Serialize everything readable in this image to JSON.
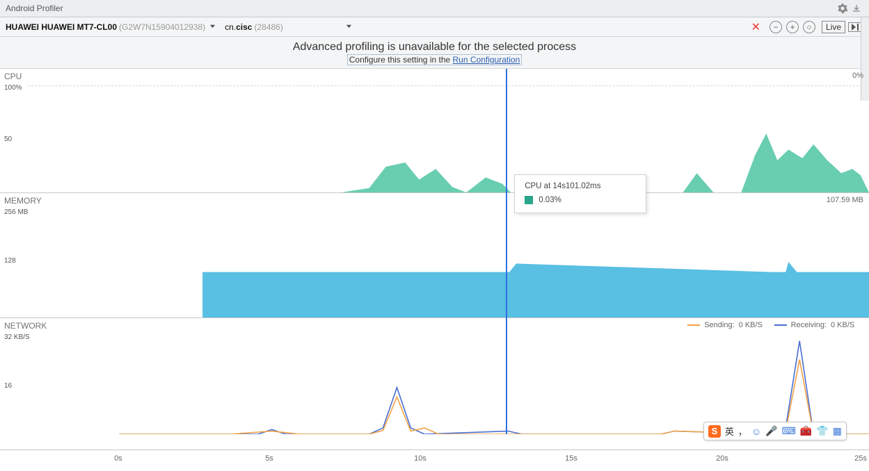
{
  "titlebar": {
    "title": "Android Profiler"
  },
  "toolbar": {
    "device_name": "HUAWEI HUAWEI MT7-CL00",
    "device_serial": "(G2W7N15904012938)",
    "process_prefix": "cn.",
    "process_bold": "cisc",
    "process_pid": "(28486)",
    "live_label": "Live"
  },
  "banner": {
    "headline": "Advanced profiling is unavailable for the selected process",
    "sub_prefix": "Configure this setting in the ",
    "sub_link": "Run Configuration"
  },
  "cpu": {
    "title": "CPU",
    "value": "0%",
    "yticks": {
      "max": "100%",
      "mid": "50"
    }
  },
  "memory": {
    "title": "MEMORY",
    "value": "107.59 MB",
    "yticks": {
      "max": "256 MB",
      "mid": "128"
    }
  },
  "network": {
    "title": "NETWORK",
    "yticks": {
      "max": "32 KB/S",
      "mid": "16"
    },
    "legend": {
      "sending_label": "Sending:",
      "sending_value": "0 KB/S",
      "receiving_label": "Receiving:",
      "receiving_value": "0 KB/S"
    }
  },
  "tooltip": {
    "title": "CPU at 14s101.02ms",
    "value": "0.03%",
    "swatch_color": "#2aa58a"
  },
  "xaxis": {
    "ticks": [
      "0s",
      "5s",
      "10s",
      "15s",
      "20s",
      "25s"
    ]
  },
  "ime": {
    "lang": "英",
    "punct": "，"
  },
  "colors": {
    "cpu_area": "#4fc6a1",
    "mem_area": "#47b8e0",
    "net_send": "#f2a246",
    "net_recv": "#4a6fd0",
    "cursor": "#2f6fe0"
  },
  "chart_data": [
    {
      "type": "area",
      "title": "CPU",
      "ylabel": "%",
      "ylim": [
        0,
        100
      ],
      "xlim": [
        0,
        27
      ],
      "x_unit": "s",
      "series": [
        {
          "name": "CPU %",
          "x": [
            0,
            8,
            9,
            9.6,
            10.3,
            10.8,
            11.4,
            12,
            12.5,
            13.2,
            13.8,
            14.1,
            20.3,
            20.8,
            21.2,
            21.4,
            22.4,
            22.9,
            23.3,
            23.7,
            24.1,
            24.6,
            25,
            25.5,
            26,
            26.4,
            26.7,
            27
          ],
          "values": [
            0,
            0,
            4,
            24,
            28,
            12,
            22,
            5,
            0,
            14,
            8,
            0,
            0,
            18,
            6,
            0,
            0,
            35,
            55,
            30,
            40,
            32,
            45,
            30,
            18,
            22,
            16,
            0
          ]
        }
      ]
    },
    {
      "type": "area",
      "title": "MEMORY",
      "ylabel": "MB",
      "ylim": [
        0,
        256
      ],
      "xlim": [
        0,
        27
      ],
      "x_unit": "s",
      "series": [
        {
          "name": "Memory MB",
          "x": [
            0,
            3,
            3,
            14,
            14.05,
            14.3,
            23.5,
            24,
            24.1,
            24.4,
            27
          ],
          "values": [
            0,
            0,
            108,
            108,
            108,
            128,
            108,
            108,
            132,
            108,
            108
          ]
        }
      ]
    },
    {
      "type": "line",
      "title": "NETWORK",
      "ylabel": "KB/S",
      "ylim": [
        0,
        32
      ],
      "xlim": [
        0,
        27
      ],
      "x_unit": "s",
      "series": [
        {
          "name": "Sending",
          "x": [
            0,
            4,
            5.5,
            6.5,
            9,
            9.5,
            10,
            10.5,
            11,
            11.5,
            14,
            15,
            19.5,
            20,
            23.5,
            24,
            24.5,
            25,
            27
          ],
          "values": [
            0,
            0,
            1,
            0,
            0,
            1.2,
            12,
            1,
            2,
            0,
            0,
            0,
            0,
            1,
            0,
            1,
            24,
            0,
            0
          ]
        },
        {
          "name": "Receiving",
          "x": [
            0,
            5,
            5.5,
            6,
            9,
            9.5,
            10,
            10.5,
            11,
            14,
            14.5,
            19.5,
            20,
            23.5,
            24,
            24.5,
            25,
            27
          ],
          "values": [
            0,
            0,
            1.5,
            0,
            0,
            2,
            15,
            2,
            0,
            1,
            0,
            0,
            1,
            0,
            2,
            30,
            0,
            0
          ]
        }
      ]
    }
  ]
}
